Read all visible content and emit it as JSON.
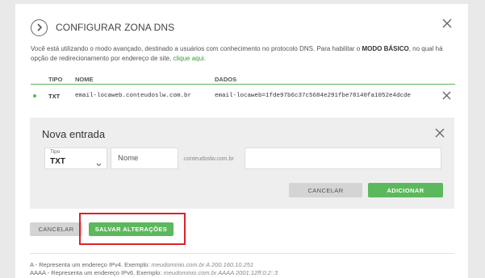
{
  "dialog": {
    "title": "CONFIGURAR ZONA DNS",
    "intro_text": "Você está utilizando o modo avançado, destinado a usuários com conhecimento no protocolo DNS. Para habilitar o ",
    "intro_bold": "MODO BÁSICO",
    "intro_text2": ", no qual há opção de redirecionamento por endereço de site, ",
    "intro_link": "clique aqui."
  },
  "table": {
    "headers": {
      "tipo": "TIPO",
      "nome": "NOME",
      "dados": "DADOS"
    },
    "rows": [
      {
        "tipo": "TXT",
        "nome": "email-locaweb.conteudoslw.com.br",
        "dados": "email-locaweb=1fde97b6c37c5684e291fbe78140fa1052e4dcde"
      }
    ]
  },
  "new_entry": {
    "title": "Nova entrada",
    "tipo_label": "Tipo",
    "tipo_value": "TXT",
    "nome_placeholder": "Nome",
    "domain_suffix": ".conteudoslw.com.br",
    "cancel_label": "CANCELAR",
    "add_label": "ADICIONAR"
  },
  "actions": {
    "cancel_label": "CANCELAR",
    "save_label": "SALVAR ALTERAÇÕES"
  },
  "legend": [
    {
      "type": "A",
      "desc": " - Representa um endereço IPv4. Exemplo: ",
      "example": "meudominio.com.br A 200.160.10.251"
    },
    {
      "type": "AAAA",
      "desc": " - Representa um endereço IPv6. Exemplo: ",
      "example": "meudominio.com.br AAAA 2001:12ff:0:2::3"
    }
  ],
  "colors": {
    "accent": "#5cb85c",
    "highlight": "#d9232a",
    "link": "#3a9a3c"
  }
}
